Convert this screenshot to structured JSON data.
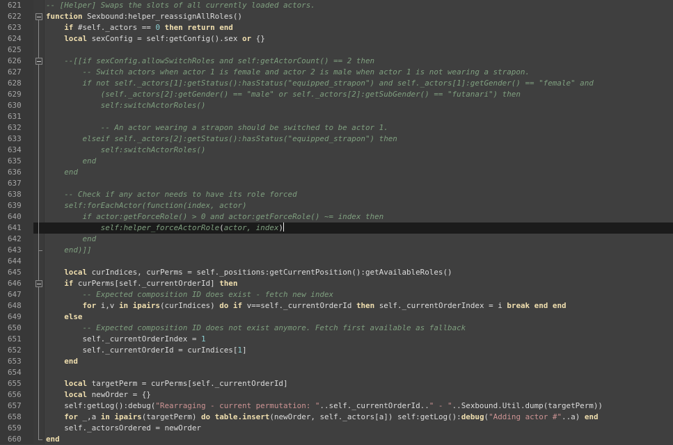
{
  "editor": {
    "theme": {
      "background": "#3f3f3f",
      "current_line": "#1b1b1b",
      "keyword": "#f0dfaf",
      "comment": "#7f9f7f",
      "string": "#cc9393",
      "number": "#8cd0d3"
    },
    "cursor": {
      "line": 641
    },
    "lines": [
      {
        "n": "621",
        "fold": "none",
        "tokens": [
          {
            "t": "cm",
            "v": "-- [Helper] Swaps the slots of all currently loaded actors."
          }
        ]
      },
      {
        "n": "622",
        "fold": "open",
        "tokens": [
          {
            "t": "kw",
            "v": "function"
          },
          {
            "t": "pl",
            "v": " Sexbound:helper_reassignAllRoles()"
          }
        ]
      },
      {
        "n": "623",
        "fold": "line",
        "tokens": [
          {
            "t": "pl",
            "v": "    "
          },
          {
            "t": "kw",
            "v": "if"
          },
          {
            "t": "pl",
            "v": " #self._actors == "
          },
          {
            "t": "nm",
            "v": "0"
          },
          {
            "t": "pl",
            "v": " "
          },
          {
            "t": "kw",
            "v": "then return end"
          }
        ]
      },
      {
        "n": "624",
        "fold": "line",
        "tokens": [
          {
            "t": "pl",
            "v": "    "
          },
          {
            "t": "kw",
            "v": "local"
          },
          {
            "t": "pl",
            "v": " sexConfig = self:getConfig().sex "
          },
          {
            "t": "kw",
            "v": "or"
          },
          {
            "t": "pl",
            "v": " {}"
          }
        ]
      },
      {
        "n": "625",
        "fold": "line",
        "tokens": []
      },
      {
        "n": "626",
        "fold": "open",
        "tokens": [
          {
            "t": "pl",
            "v": "    "
          },
          {
            "t": "cm",
            "v": "--[[if sexConfig.allowSwitchRoles and self:getActorCount() == 2 then"
          }
        ]
      },
      {
        "n": "627",
        "fold": "line",
        "tokens": [
          {
            "t": "cm",
            "v": "        -- Switch actors when actor 1 is female and actor 2 is male when actor 1 is not wearing a strapon."
          }
        ]
      },
      {
        "n": "628",
        "fold": "line",
        "tokens": [
          {
            "t": "cm",
            "v": "        if not self._actors[1]:getStatus():hasStatus(\"equipped_strapon\") and self._actors[1]:getGender() == \"female\" and"
          }
        ]
      },
      {
        "n": "629",
        "fold": "line",
        "tokens": [
          {
            "t": "cm",
            "v": "            (self._actors[2]:getGender() == \"male\" or self._actors[2]:getSubGender() == \"futanari\") then"
          }
        ]
      },
      {
        "n": "630",
        "fold": "line",
        "tokens": [
          {
            "t": "cm",
            "v": "            self:switchActorRoles()"
          }
        ]
      },
      {
        "n": "631",
        "fold": "line",
        "tokens": []
      },
      {
        "n": "632",
        "fold": "line",
        "tokens": [
          {
            "t": "cm",
            "v": "            -- An actor wearing a strapon should be switched to be actor 1."
          }
        ]
      },
      {
        "n": "633",
        "fold": "line",
        "tokens": [
          {
            "t": "cm",
            "v": "        elseif self._actors[2]:getStatus():hasStatus(\"equipped_strapon\") then"
          }
        ]
      },
      {
        "n": "634",
        "fold": "line",
        "tokens": [
          {
            "t": "cm",
            "v": "            self:switchActorRoles()"
          }
        ]
      },
      {
        "n": "635",
        "fold": "line",
        "tokens": [
          {
            "t": "cm",
            "v": "        end"
          }
        ]
      },
      {
        "n": "636",
        "fold": "line",
        "tokens": [
          {
            "t": "cm",
            "v": "    end"
          }
        ]
      },
      {
        "n": "637",
        "fold": "line",
        "tokens": []
      },
      {
        "n": "638",
        "fold": "line",
        "tokens": [
          {
            "t": "cm",
            "v": "    -- Check if any actor needs to have its role forced"
          }
        ]
      },
      {
        "n": "639",
        "fold": "line",
        "tokens": [
          {
            "t": "cm",
            "v": "    self:forEachActor(function(index, actor)"
          }
        ]
      },
      {
        "n": "640",
        "fold": "line",
        "tokens": [
          {
            "t": "cm",
            "v": "        if actor:getForceRole() > 0 and actor:getForceRole() ~= index then"
          }
        ]
      },
      {
        "n": "641",
        "fold": "line",
        "current": true,
        "tokens": [
          {
            "t": "cm",
            "v": "            self:helper_forceActorRole"
          },
          {
            "t": "pl",
            "v": "("
          },
          {
            "t": "cm",
            "v": "actor, index"
          },
          {
            "t": "pl",
            "v": ")"
          }
        ]
      },
      {
        "n": "642",
        "fold": "line",
        "tokens": [
          {
            "t": "cm",
            "v": "        end"
          }
        ]
      },
      {
        "n": "643",
        "fold": "end",
        "tokens": [
          {
            "t": "cm",
            "v": "    end)]]"
          }
        ]
      },
      {
        "n": "644",
        "fold": "line",
        "tokens": []
      },
      {
        "n": "645",
        "fold": "line",
        "tokens": [
          {
            "t": "pl",
            "v": "    "
          },
          {
            "t": "kw",
            "v": "local"
          },
          {
            "t": "pl",
            "v": " curIndices, curPerms = self._positions:getCurrentPosition():getAvailableRoles()"
          }
        ]
      },
      {
        "n": "646",
        "fold": "open",
        "tokens": [
          {
            "t": "pl",
            "v": "    "
          },
          {
            "t": "kw",
            "v": "if"
          },
          {
            "t": "pl",
            "v": " curPerms[self._currentOrderId] "
          },
          {
            "t": "kw",
            "v": "then"
          }
        ]
      },
      {
        "n": "647",
        "fold": "line",
        "tokens": [
          {
            "t": "pl",
            "v": "        "
          },
          {
            "t": "cm",
            "v": "-- Expected composition ID does exist - fetch new index"
          }
        ]
      },
      {
        "n": "648",
        "fold": "line",
        "tokens": [
          {
            "t": "pl",
            "v": "        "
          },
          {
            "t": "kw",
            "v": "for"
          },
          {
            "t": "pl",
            "v": " i,v "
          },
          {
            "t": "kw",
            "v": "in"
          },
          {
            "t": "pl",
            "v": " "
          },
          {
            "t": "kw",
            "v": "ipairs"
          },
          {
            "t": "pl",
            "v": "(curIndices) "
          },
          {
            "t": "kw",
            "v": "do if"
          },
          {
            "t": "pl",
            "v": " v==self._currentOrderId "
          },
          {
            "t": "kw",
            "v": "then"
          },
          {
            "t": "pl",
            "v": " self._currentOrderIndex = i "
          },
          {
            "t": "kw",
            "v": "break end end"
          }
        ]
      },
      {
        "n": "649",
        "fold": "line",
        "tokens": [
          {
            "t": "pl",
            "v": "    "
          },
          {
            "t": "kw",
            "v": "else"
          }
        ]
      },
      {
        "n": "650",
        "fold": "line",
        "tokens": [
          {
            "t": "pl",
            "v": "        "
          },
          {
            "t": "cm",
            "v": "-- Expected composition ID does not exist anymore. Fetch first available as fallback"
          }
        ]
      },
      {
        "n": "651",
        "fold": "line",
        "tokens": [
          {
            "t": "pl",
            "v": "        self._currentOrderIndex = "
          },
          {
            "t": "nm",
            "v": "1"
          }
        ]
      },
      {
        "n": "652",
        "fold": "line",
        "tokens": [
          {
            "t": "pl",
            "v": "        self._currentOrderId = curIndices["
          },
          {
            "t": "nm",
            "v": "1"
          },
          {
            "t": "pl",
            "v": "]"
          }
        ]
      },
      {
        "n": "653",
        "fold": "line",
        "tokens": [
          {
            "t": "pl",
            "v": "    "
          },
          {
            "t": "kw",
            "v": "end"
          }
        ]
      },
      {
        "n": "654",
        "fold": "line",
        "tokens": []
      },
      {
        "n": "655",
        "fold": "line",
        "tokens": [
          {
            "t": "pl",
            "v": "    "
          },
          {
            "t": "kw",
            "v": "local"
          },
          {
            "t": "pl",
            "v": " targetPerm = curPerms[self._currentOrderId]"
          }
        ]
      },
      {
        "n": "656",
        "fold": "line",
        "tokens": [
          {
            "t": "pl",
            "v": "    "
          },
          {
            "t": "kw",
            "v": "local"
          },
          {
            "t": "pl",
            "v": " newOrder = {}"
          }
        ]
      },
      {
        "n": "657",
        "fold": "line",
        "tokens": [
          {
            "t": "pl",
            "v": "    self:getLog():debug("
          },
          {
            "t": "st",
            "v": "\"Rearraging - current permutation: \""
          },
          {
            "t": "pl",
            "v": "..self._currentOrderId.."
          },
          {
            "t": "st",
            "v": "\" - \""
          },
          {
            "t": "pl",
            "v": "..Sexbound.Util.dump(targetPerm))"
          }
        ]
      },
      {
        "n": "658",
        "fold": "line",
        "tokens": [
          {
            "t": "pl",
            "v": "    "
          },
          {
            "t": "kw",
            "v": "for"
          },
          {
            "t": "pl",
            "v": " _,a "
          },
          {
            "t": "kw",
            "v": "in"
          },
          {
            "t": "pl",
            "v": " "
          },
          {
            "t": "kw",
            "v": "ipairs"
          },
          {
            "t": "pl",
            "v": "(targetPerm) "
          },
          {
            "t": "kw",
            "v": "do"
          },
          {
            "t": "pl",
            "v": " "
          },
          {
            "t": "kw",
            "v": "table.insert"
          },
          {
            "t": "pl",
            "v": "(newOrder, self._actors[a]) self:getLog():"
          },
          {
            "t": "kw",
            "v": "debug"
          },
          {
            "t": "pl",
            "v": "("
          },
          {
            "t": "st",
            "v": "\"Adding actor #\""
          },
          {
            "t": "pl",
            "v": "..a) "
          },
          {
            "t": "kw",
            "v": "end"
          }
        ]
      },
      {
        "n": "659",
        "fold": "line",
        "tokens": [
          {
            "t": "pl",
            "v": "    self._actorsOrdered = newOrder"
          }
        ]
      },
      {
        "n": "660",
        "fold": "end",
        "tokens": [
          {
            "t": "kw",
            "v": "end"
          }
        ]
      }
    ]
  }
}
